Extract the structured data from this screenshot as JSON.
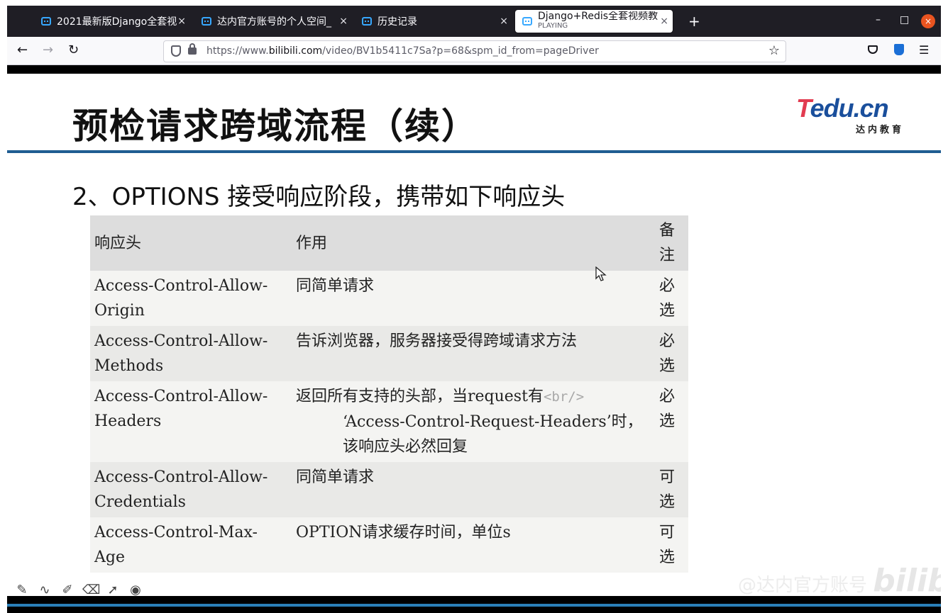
{
  "browser": {
    "tabs": [
      {
        "title": "2021最新版Django全套视",
        "active": false
      },
      {
        "title": "达内官方账号的个人空间_",
        "active": false
      },
      {
        "title": "历史记录",
        "active": false
      },
      {
        "title": "Django+Redis全套视频教",
        "subtitle": "PLAYING",
        "active": true
      }
    ],
    "close_glyph": "×",
    "new_tab_glyph": "+",
    "window_controls": {
      "minimize": "–",
      "maximize": "□",
      "close": "×"
    },
    "url": {
      "scheme": "https://www.",
      "host": "bilibili.com",
      "path": "/video/BV1b5411c7Sa?p=68&spm_id_from=pageDriver"
    },
    "nav": {
      "back": "←",
      "forward": "→",
      "reload": "↻",
      "bookmark": "☆",
      "menu": "☰"
    },
    "icons": {
      "accent": "#37a8ff"
    }
  },
  "slide": {
    "title": "预检请求跨域流程（续）",
    "logo": {
      "main_t": "T",
      "main_rest": "edu.cn",
      "sub": "达内教育"
    },
    "subtitle": "2、OPTIONS 接受响应阶段，携带如下响应头",
    "table": {
      "headers": [
        "响应头",
        "作用",
        "备注"
      ],
      "rows": [
        {
          "name": "Access-Control-Allow-Origin",
          "desc": "同简单请求",
          "note": "必选"
        },
        {
          "name": "Access-Control-Allow-Methods",
          "desc": "告诉浏览器，服务器接受得跨域请求方法",
          "note": "必选"
        },
        {
          "name": "Access-Control-Allow-Headers",
          "desc_a": "返回所有支持的头部，当request有",
          "desc_tag": "<br/>",
          "desc_b": "‘Access-Control-Request-Headers’时，该响应头必然回复",
          "note": "必选"
        },
        {
          "name": "Access-Control-Allow-Credentials",
          "desc": "同简单请求",
          "note": "可选"
        },
        {
          "name": "Access-Control-Max-Age",
          "desc": "OPTION请求缓存时间，单位s",
          "note": "可选"
        }
      ]
    },
    "colors": {
      "rule": "#1f5d92",
      "logo_blue": "#1a4f9c",
      "logo_red": "#e23b50"
    }
  },
  "player": {
    "watermark_text": "@达内官方账号",
    "watermark_brand": "bilibili",
    "tools": [
      "pen-icon",
      "curve-icon",
      "highlighter-icon",
      "eraser-icon",
      "pointer-icon",
      "record-icon"
    ]
  }
}
